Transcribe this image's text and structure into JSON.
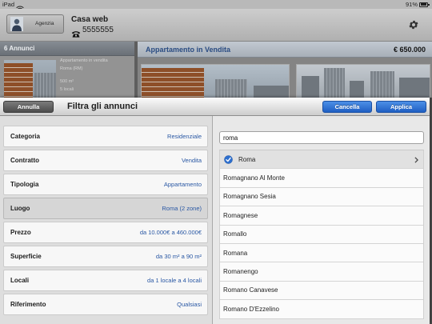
{
  "status_bar": {
    "device": "iPad",
    "battery": "91%",
    "battery_level": 0.91
  },
  "header": {
    "agency_button_label": "Agenzia",
    "title": "Casa web",
    "phone": "5555555"
  },
  "listings": {
    "count_label": "6 Annunci",
    "item": {
      "title": "Appartamento in vendita",
      "location": "Roma (RM)",
      "size": "500 m²",
      "rooms": "5 locali"
    }
  },
  "detail": {
    "title": "Appartamento in Vendita",
    "price": "€ 650.000"
  },
  "filter_sheet": {
    "cancel_label": "Annulla",
    "title": "Filtra gli annunci",
    "clear_label": "Cancella",
    "apply_label": "Applica",
    "filters": [
      {
        "label": "Categoria",
        "value": "Residenziale",
        "selected": false
      },
      {
        "label": "Contratto",
        "value": "Vendita",
        "selected": false
      },
      {
        "label": "Tipologia",
        "value": "Appartamento",
        "selected": false
      },
      {
        "label": "Luogo",
        "value": "Roma (2 zone)",
        "selected": true
      },
      {
        "label": "Prezzo",
        "value": "da 10.000€ a 460.000€",
        "selected": false
      },
      {
        "label": "Superficie",
        "value": "da 30 m² a 90 m²",
        "selected": false
      },
      {
        "label": "Locali",
        "value": "da 1 locale a 4 locali",
        "selected": false
      },
      {
        "label": "Riferimento",
        "value": "Qualsiasi",
        "selected": false
      }
    ],
    "search": {
      "value": "roma"
    },
    "results": [
      {
        "name": "Roma",
        "checked": true
      },
      {
        "name": "Romagnano Al Monte",
        "checked": false
      },
      {
        "name": "Romagnano Sesia",
        "checked": false
      },
      {
        "name": "Romagnese",
        "checked": false
      },
      {
        "name": "Romallo",
        "checked": false
      },
      {
        "name": "Romana",
        "checked": false
      },
      {
        "name": "Romanengo",
        "checked": false
      },
      {
        "name": "Romano Canavese",
        "checked": false
      },
      {
        "name": "Romano D'Ezzelino",
        "checked": false
      }
    ]
  },
  "icons": {
    "wifi": "wifi-icon",
    "battery": "battery-icon",
    "agency": "agency-avatar-icon",
    "phone": "phone-icon",
    "settings": "gear-icon",
    "checked": "check-circle-icon",
    "disclosure": "chevron-right-icon"
  },
  "colors": {
    "accent_blue": "#2f6fd6",
    "filter_value_blue": "#2a58a4",
    "check_blue": "#2d6fce",
    "dark_button": "#5a5a5a",
    "detail_title_blue": "#2a4c82"
  }
}
